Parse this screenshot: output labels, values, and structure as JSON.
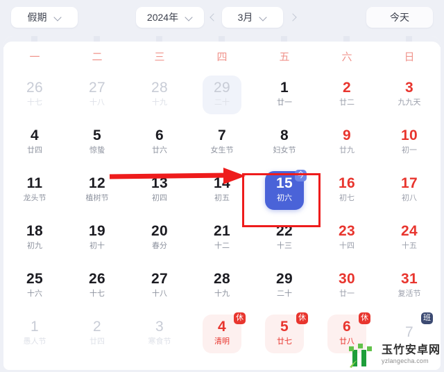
{
  "toolbar": {
    "holiday_selector": {
      "label": "假期",
      "icon": "chevron-down-icon"
    },
    "year_selector": {
      "label": "2024年",
      "icon": "chevron-down-icon"
    },
    "month_selector": {
      "label": "3月",
      "icon": "chevron-down-icon"
    },
    "prev_month": {
      "icon": "chevron-left-icon"
    },
    "next_month": {
      "icon": "chevron-right-icon"
    },
    "today_button": {
      "label": "今天"
    }
  },
  "weekdays": [
    "一",
    "二",
    "三",
    "四",
    "五",
    "六",
    "日"
  ],
  "colors": {
    "app_background": "#eef0f6",
    "card_background": "#ffffff",
    "weekday_header": "#f0948c",
    "weekend_red": "#e8352e",
    "today_blue": "#4a63d8",
    "rest_badge": "#e8352e",
    "work_badge": "#3c4a72",
    "annotation_red": "#ee1c1c"
  },
  "weeks": [
    [
      {
        "day": "26",
        "lunar": "十七",
        "state": "out"
      },
      {
        "day": "27",
        "lunar": "十八",
        "state": "out"
      },
      {
        "day": "28",
        "lunar": "十九",
        "state": "out"
      },
      {
        "day": "29",
        "lunar": "二十",
        "state": "out softsel"
      },
      {
        "day": "1",
        "lunar": "廿一",
        "state": ""
      },
      {
        "day": "2",
        "lunar": "廿二",
        "state": "weekend"
      },
      {
        "day": "3",
        "lunar": "九九天",
        "state": "weekend"
      }
    ],
    [
      {
        "day": "4",
        "lunar": "廿四",
        "state": ""
      },
      {
        "day": "5",
        "lunar": "惊蛰",
        "state": ""
      },
      {
        "day": "6",
        "lunar": "廿六",
        "state": ""
      },
      {
        "day": "7",
        "lunar": "女生节",
        "state": ""
      },
      {
        "day": "8",
        "lunar": "妇女节",
        "state": ""
      },
      {
        "day": "9",
        "lunar": "廿九",
        "state": "weekend"
      },
      {
        "day": "10",
        "lunar": "初一",
        "state": "weekend"
      }
    ],
    [
      {
        "day": "11",
        "lunar": "龙头节",
        "state": ""
      },
      {
        "day": "12",
        "lunar": "植树节",
        "state": ""
      },
      {
        "day": "13",
        "lunar": "初四",
        "state": ""
      },
      {
        "day": "14",
        "lunar": "初五",
        "state": ""
      },
      {
        "day": "15",
        "lunar": "初六",
        "state": "today",
        "badge": "今",
        "badge_type": "today"
      },
      {
        "day": "16",
        "lunar": "初七",
        "state": "weekend"
      },
      {
        "day": "17",
        "lunar": "初八",
        "state": "weekend"
      }
    ],
    [
      {
        "day": "18",
        "lunar": "初九",
        "state": ""
      },
      {
        "day": "19",
        "lunar": "初十",
        "state": ""
      },
      {
        "day": "20",
        "lunar": "春分",
        "state": ""
      },
      {
        "day": "21",
        "lunar": "十二",
        "state": ""
      },
      {
        "day": "22",
        "lunar": "十三",
        "state": ""
      },
      {
        "day": "23",
        "lunar": "十四",
        "state": "weekend"
      },
      {
        "day": "24",
        "lunar": "十五",
        "state": "weekend"
      }
    ],
    [
      {
        "day": "25",
        "lunar": "十六",
        "state": ""
      },
      {
        "day": "26",
        "lunar": "十七",
        "state": ""
      },
      {
        "day": "27",
        "lunar": "十八",
        "state": ""
      },
      {
        "day": "28",
        "lunar": "十九",
        "state": ""
      },
      {
        "day": "29",
        "lunar": "二十",
        "state": ""
      },
      {
        "day": "30",
        "lunar": "廿一",
        "state": "weekend"
      },
      {
        "day": "31",
        "lunar": "复活节",
        "state": "weekend"
      }
    ],
    [
      {
        "day": "1",
        "lunar": "愚人节",
        "state": "out"
      },
      {
        "day": "2",
        "lunar": "廿四",
        "state": "out"
      },
      {
        "day": "3",
        "lunar": "寒食节",
        "state": "out"
      },
      {
        "day": "4",
        "lunar": "清明",
        "state": "holiday",
        "badge": "休",
        "badge_type": "rest"
      },
      {
        "day": "5",
        "lunar": "廿七",
        "state": "holiday",
        "badge": "休",
        "badge_type": "rest"
      },
      {
        "day": "6",
        "lunar": "廿八",
        "state": "holiday",
        "badge": "休",
        "badge_type": "rest"
      },
      {
        "day": "7",
        "lunar": "",
        "state": "out",
        "badge": "班",
        "badge_type": "work"
      }
    ]
  ],
  "annotations": [
    {
      "kind": "rect",
      "name": "today-highlight-box"
    },
    {
      "kind": "arrow",
      "name": "pointer-arrow"
    }
  ],
  "watermark": {
    "name": "玉竹安卓网",
    "url": "yzlangecha.com"
  }
}
